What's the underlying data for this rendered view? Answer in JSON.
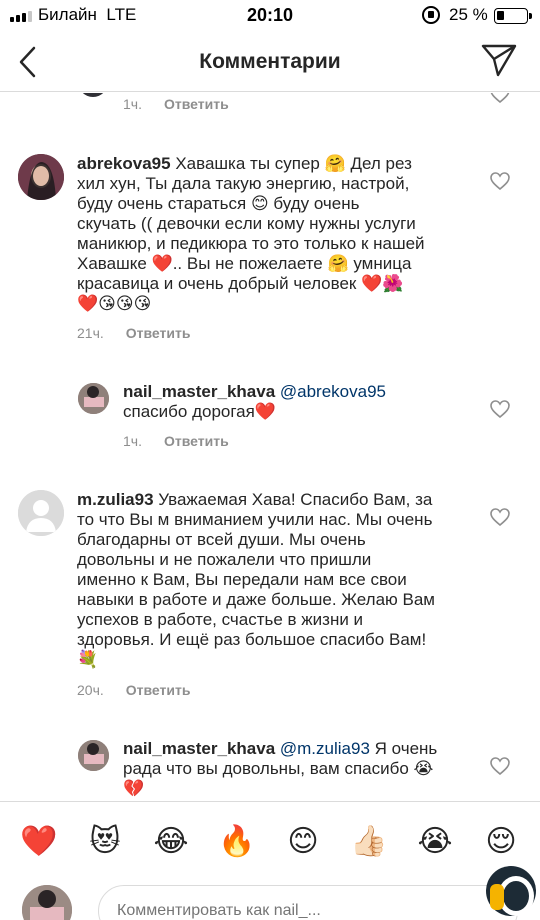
{
  "status_bar": {
    "carrier": "Билайн",
    "network": "LTE",
    "time": "20:10",
    "battery": "25 %"
  },
  "header": {
    "title": "Комментарии",
    "back_icon": "chevron-left-icon",
    "direct_icon": "paper-plane-icon"
  },
  "comments": [
    {
      "id": "top-partial",
      "time": "1ч.",
      "reply_label": "Ответить"
    },
    {
      "id": "abrekova",
      "username": "abrekova95",
      "lines": [
        "Хавашка ты супер 🤗 Дел рез",
        "хил хун,  Ты дала такую энергию, настрой,",
        "буду очень стараться 😊  буду очень",
        "скучать (( девочки если кому нужны услуги",
        "маникюр, и педикюра то это только к нашей",
        "Хавашке ❤️.. Вы не пожелаете 🤗  умница",
        "красавица  и очень добрый человек ❤️🌺",
        "❤️😘😘😘"
      ],
      "time": "21ч.",
      "reply_label": "Ответить"
    },
    {
      "id": "reply-1",
      "username": "nail_master_khava",
      "mention": "@abrekova95",
      "lines": [
        "спасибо дорогая❤️"
      ],
      "time": "1ч.",
      "reply_label": "Ответить"
    },
    {
      "id": "zulia",
      "username": "m.zulia93",
      "lines": [
        "Уважаемая Хава! Спасибо Вам, за",
        "то что Вы м вниманием учили нас. Мы очень",
        "благодарны от всей души. Мы очень",
        "довольны и не пожалели что пришли",
        "именно к Вам, Вы передали нам все свои",
        "навыки в работе и даже больше. Желаю Вам",
        "успехов в работе, счастье в жизни и",
        "здоровья. И ещё раз большое спасибо Вам!",
        "💐"
      ],
      "time": "20ч.",
      "reply_label": "Ответить"
    },
    {
      "id": "reply-2",
      "username": "nail_master_khava",
      "mention": "@m.zulia93",
      "lines": [
        "Я очень",
        "рада что вы довольны, вам спасибо 😭",
        "💔"
      ]
    }
  ],
  "emoji_bar": [
    "❤️",
    "😻",
    "😂",
    "🔥",
    "😊",
    "👍🏻",
    "😭",
    "😌"
  ],
  "input": {
    "placeholder": "Комментировать как nail_..."
  },
  "colors": {
    "text": "#262626",
    "secondary": "#8e8e8e",
    "mention": "#003569",
    "divider": "#dbdbdb"
  }
}
